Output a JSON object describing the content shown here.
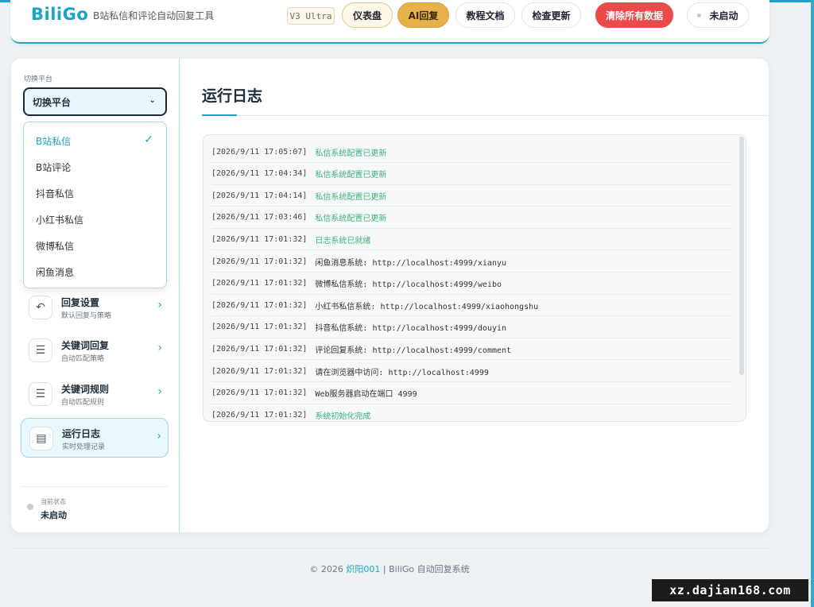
{
  "header": {
    "brand": "BiliGo",
    "subtitle": "B站私信和评论自动回复工具",
    "version": "V3 Ultra",
    "buttons": {
      "dashboard": "仪表盘",
      "ai_reply": "AI回复",
      "docs": "教程文档",
      "check_update": "检查更新",
      "clear_data": "清除所有数据",
      "status": "未启动"
    }
  },
  "sidebar": {
    "platform_label": "切换平台",
    "select_value": "切换平台",
    "dropdown": [
      {
        "label": "B站私信",
        "selected": true
      },
      {
        "label": "B站评论"
      },
      {
        "label": "抖音私信"
      },
      {
        "label": "小红书私信"
      },
      {
        "label": "微博私信"
      },
      {
        "label": "闲鱼消息"
      }
    ],
    "nav": [
      {
        "title": "回复设置",
        "sub": "默认回复与策略"
      },
      {
        "title": "关键词回复",
        "sub": "自动匹配策略"
      },
      {
        "title": "关键词规则",
        "sub": "自动匹配规则"
      },
      {
        "title": "运行日志",
        "sub": "实时处理记录"
      }
    ],
    "status_label": "当前状态",
    "status_value": "未启动"
  },
  "main": {
    "title": "运行日志",
    "logs": [
      {
        "time": "[2026/9/11 17:05:07]",
        "msg": "私信系统配置已更新",
        "green": true
      },
      {
        "time": "[2026/9/11 17:04:34]",
        "msg": "私信系统配置已更新",
        "green": true
      },
      {
        "time": "[2026/9/11 17:04:14]",
        "msg": "私信系统配置已更新",
        "green": true
      },
      {
        "time": "[2026/9/11 17:03:46]",
        "msg": "私信系统配置已更新",
        "green": true
      },
      {
        "time": "[2026/9/11 17:01:32]",
        "msg": "日志系统已就绪",
        "green": true
      },
      {
        "time": "[2026/9/11 17:01:32]",
        "msg": "闲鱼消息系统: http://localhost:4999/xianyu",
        "green": false
      },
      {
        "time": "[2026/9/11 17:01:32]",
        "msg": "微博私信系统: http://localhost:4999/weibo",
        "green": false
      },
      {
        "time": "[2026/9/11 17:01:32]",
        "msg": "小红书私信系统: http://localhost:4999/xiaohongshu",
        "green": false
      },
      {
        "time": "[2026/9/11 17:01:32]",
        "msg": "抖音私信系统: http://localhost:4999/douyin",
        "green": false
      },
      {
        "time": "[2026/9/11 17:01:32]",
        "msg": "评论回复系统: http://localhost:4999/comment",
        "green": false
      },
      {
        "time": "[2026/9/11 17:01:32]",
        "msg": "请在浏览器中访问: http://localhost:4999",
        "green": false
      },
      {
        "time": "[2026/9/11 17:01:32]",
        "msg": "Web服务器启动在端口 4999",
        "green": false
      },
      {
        "time": "[2026/9/11 17:01:32]",
        "msg": "系统初始化完成",
        "green": true
      }
    ]
  },
  "footer": {
    "prefix": "© 2026",
    "author": "炽阳001",
    "suffix": "| BiliGo 自动回复系统"
  },
  "watermark": "xz.dajian168.com",
  "icons": {
    "check": "✓",
    "caret": "⌄",
    "arrow": "›",
    "reply": "↶",
    "sliders": "☰",
    "doc": "▤"
  }
}
